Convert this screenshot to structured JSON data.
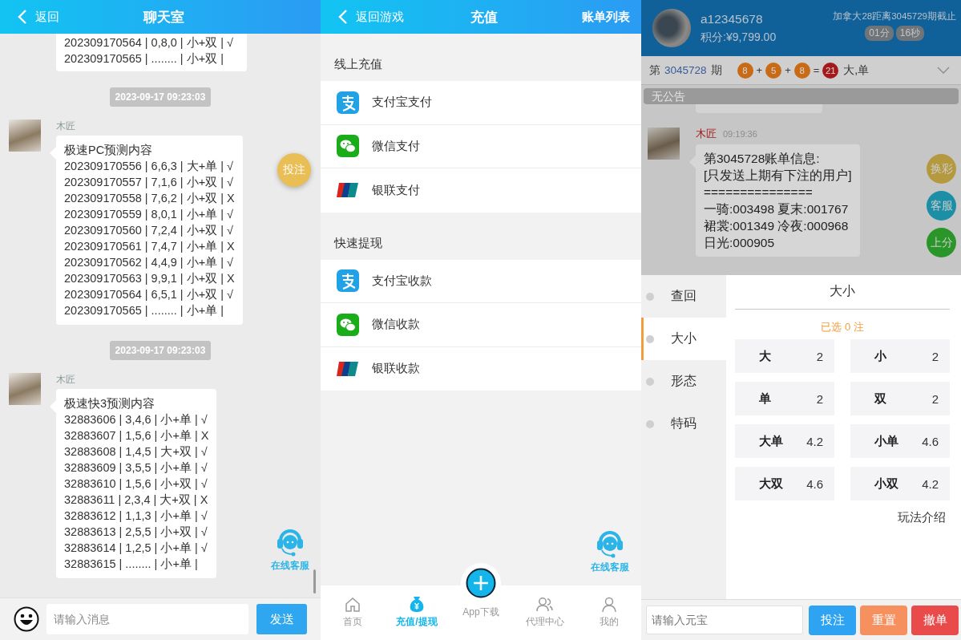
{
  "chat_room": {
    "back": "返回",
    "title": "聊天室",
    "top_message": {
      "lines": [
        "202309170564 | 0,8,0 | 小+双 | √",
        "202309170565 | ........ | 小+双 |"
      ]
    },
    "messages": [
      {
        "time": "2023-09-17 09:23:03",
        "sender": "木匠",
        "lines": [
          "极速PC预测内容",
          "202309170556 | 6,6,3 | 大+单 | √",
          "202309170557 | 7,1,6 | 小+双 | √",
          "202309170558 | 7,6,2 | 小+双 | X",
          "202309170559 | 8,0,1 | 小+单 | √",
          "202309170560 | 7,2,4 | 小+双 | √",
          "202309170561 | 7,4,7 | 小+单 | X",
          "202309170562 | 4,4,9 | 小+单 | √",
          "202309170563 | 9,9,1 | 小+双 | X",
          "202309170564 | 6,5,1 | 小+双 | √",
          "202309170565 | ........ | 小+单 |"
        ]
      },
      {
        "time": "2023-09-17 09:23:03",
        "sender": "木匠",
        "lines": [
          "极速快3预测内容",
          "32883606 | 3,4,6 | 小+单 | √",
          "32883607 | 1,5,6 | 小+单 | X",
          "32883608 | 1,4,5 | 大+双 | √",
          "32883609 | 3,5,5 | 小+单 | √",
          "32883610 | 1,5,6 | 小+双 | √",
          "32883611 | 2,3,4 | 大+双 | X",
          "32883612 | 1,1,3 | 小+单 | √",
          "32883613 | 2,5,5 | 小+双 | √",
          "32883614 | 1,2,5 | 小+单 | √",
          "32883615 | ........ | 小+单 |"
        ]
      }
    ],
    "bet_button": "投注",
    "support": "在线客服",
    "input": {
      "placeholder": "请输入消息"
    },
    "send": "发送"
  },
  "recharge": {
    "back": "返回游戏",
    "title": "充值",
    "action": "账单列表",
    "sections": [
      {
        "title": "线上充值",
        "items": [
          {
            "label": "支付宝支付",
            "kind": "alipay"
          },
          {
            "label": "微信支付",
            "kind": "wechat"
          },
          {
            "label": "银联支付",
            "kind": "unionpay"
          }
        ]
      },
      {
        "title": "快速提现",
        "items": [
          {
            "label": "支付宝收款",
            "kind": "alipay"
          },
          {
            "label": "微信收款",
            "kind": "wechat"
          },
          {
            "label": "银联收款",
            "kind": "unionpay"
          }
        ]
      }
    ],
    "support": "在线客服",
    "tabs": [
      {
        "label": "首页",
        "kind": "home",
        "selected": false
      },
      {
        "label": "充值/提现",
        "kind": "money",
        "selected": true
      },
      {
        "label": "App下载",
        "kind": "plus",
        "selected": false
      },
      {
        "label": "代理中心",
        "kind": "group",
        "selected": false
      },
      {
        "label": "我的",
        "kind": "user",
        "selected": false
      }
    ]
  },
  "betting": {
    "user": {
      "name": "a12345678",
      "points": "积分:¥9,799.00"
    },
    "countdown": {
      "text": "加拿大28距离3045729期截止",
      "minutes": "01分",
      "seconds": "16秒"
    },
    "result": {
      "prefix": "第",
      "period": "3045728",
      "suffix": "期",
      "terms": [
        {
          "value": "8",
          "color": "#c96a16",
          "op": "+"
        },
        {
          "value": "5",
          "color": "#c96a16",
          "op": "+"
        },
        {
          "value": "8",
          "color": "#c96a16",
          "op": "="
        },
        {
          "value": "21",
          "color": "#a5191b"
        }
      ],
      "outcome": "大,单"
    },
    "notice": "无公告",
    "message": {
      "sender": "木匠",
      "time": "09:19:36",
      "lines": [
        "第3045728账单信息:",
        "[只发送上期有下注的用户]",
        "===============",
        "一骑:003498 夏末:001767",
        "裙裳:001349 冷夜:000968",
        "日光:000905"
      ]
    },
    "float_buttons": [
      {
        "label": "换彩",
        "color": "#b5993f"
      },
      {
        "label": "客服",
        "color": "#1c8ea6"
      },
      {
        "label": "上分",
        "color": "#2a962a"
      }
    ],
    "nav": [
      {
        "label": "查回",
        "selected": false
      },
      {
        "label": "大小",
        "selected": true
      },
      {
        "label": "形态",
        "selected": false
      },
      {
        "label": "特码",
        "selected": false
      }
    ],
    "panel_title": "大小",
    "selected_count": "已选 0 注",
    "options": [
      {
        "name": "大",
        "odds": "2"
      },
      {
        "name": "小",
        "odds": "2"
      },
      {
        "name": "单",
        "odds": "2"
      },
      {
        "name": "双",
        "odds": "2"
      },
      {
        "name": "大单",
        "odds": "4.2"
      },
      {
        "name": "小单",
        "odds": "4.6"
      },
      {
        "name": "大双",
        "odds": "4.6"
      },
      {
        "name": "小双",
        "odds": "4.2"
      }
    ],
    "rules_link": "玩法介绍",
    "amount": {
      "placeholder": "请输入元宝"
    },
    "buttons": [
      {
        "label": "投注",
        "kind": "bet"
      },
      {
        "label": "重置",
        "kind": "reset"
      },
      {
        "label": "撤单",
        "kind": "cancel"
      }
    ]
  }
}
